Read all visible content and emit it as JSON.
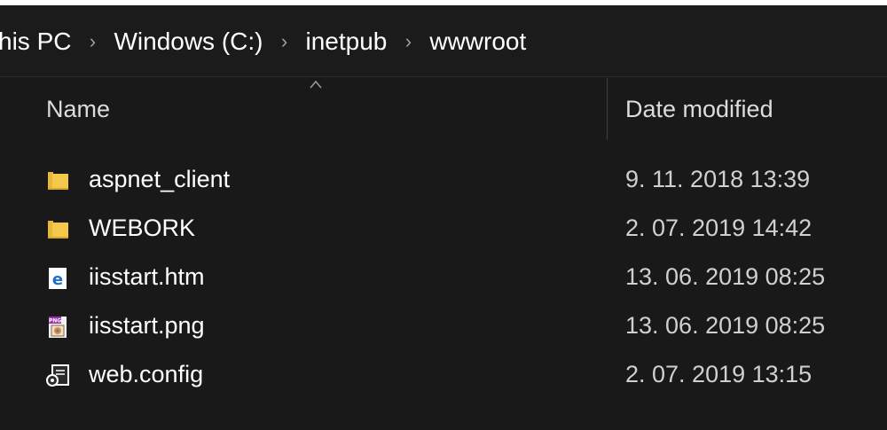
{
  "breadcrumb": {
    "items": [
      {
        "label": "his PC"
      },
      {
        "label": "Windows (C:)"
      },
      {
        "label": "inetpub"
      },
      {
        "label": "wwwroot"
      }
    ]
  },
  "columns": {
    "name": "Name",
    "date_modified": "Date modified",
    "sort": "name-ascending"
  },
  "files": [
    {
      "name": "aspnet_client",
      "date": "9. 11. 2018 13:39",
      "icon": "folder-icon"
    },
    {
      "name": "WEBORK",
      "date": "2. 07. 2019 14:42",
      "icon": "folder-icon"
    },
    {
      "name": "iisstart.htm",
      "date": "13. 06. 2019 08:25",
      "icon": "edge-html-file-icon"
    },
    {
      "name": "iisstart.png",
      "date": "13. 06. 2019 08:25",
      "icon": "png-image-file-icon"
    },
    {
      "name": "web.config",
      "date": "2. 07. 2019 13:15",
      "icon": "config-file-icon"
    }
  ],
  "colors": {
    "background": "#191919",
    "folder": "#f0c040",
    "edge_blue": "#1f6fc8",
    "text": "#ffffff"
  }
}
